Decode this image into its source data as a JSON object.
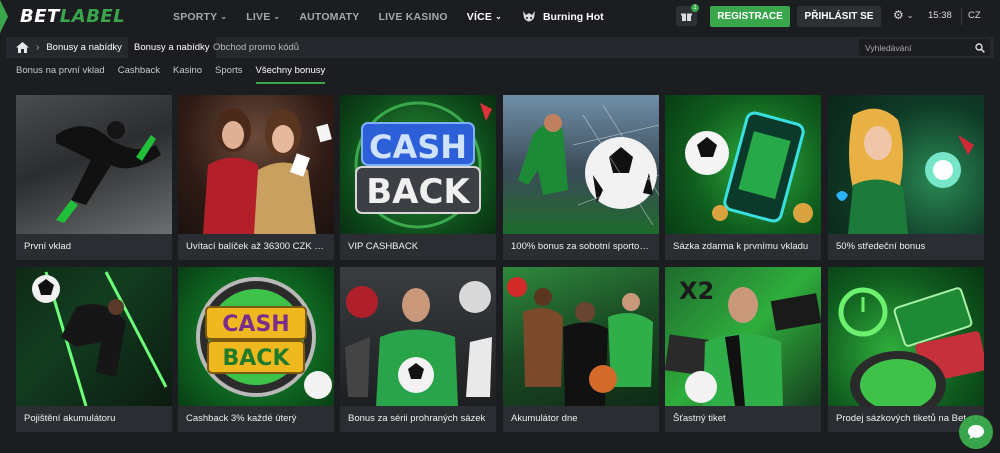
{
  "header": {
    "logo_part1": "BET",
    "logo_part2": "LABEL",
    "nav": [
      {
        "label": "SPORTY",
        "has_dropdown": true
      },
      {
        "label": "LIVE",
        "has_dropdown": true
      },
      {
        "label": "AUTOMATY",
        "has_dropdown": false
      },
      {
        "label": "LIVE KASINO",
        "has_dropdown": false
      },
      {
        "label": "VÍCE",
        "has_dropdown": true
      }
    ],
    "burning_hot": "Burning Hot",
    "gift_badge": "1",
    "register": "REGISTRACE",
    "login": "PŘIHLÁSIT SE",
    "time": "15:38",
    "language": "CZ"
  },
  "breadcrumb": {
    "items": [
      "Bonusy a nabídky"
    ],
    "tabs": [
      "Bonusy a nabídky",
      "Obchod promo kódů"
    ],
    "search_placeholder": "Vyhledávání"
  },
  "subtabs": [
    "Bonus na první vklad",
    "Cashback",
    "Kasino",
    "Sports",
    "Všechny bonusy"
  ],
  "active_subtab": "Všechny bonusy",
  "cards": [
    {
      "title": "První vklad",
      "icon": "football-player-image"
    },
    {
      "title": "Uvítací balíček až 36300 CZK + 1...",
      "icon": "casino-girls-image"
    },
    {
      "title": "VIP CASHBACK",
      "icon": "cashback-neon-image"
    },
    {
      "title": "100% bonus za sobotní sportovn...",
      "icon": "soccer-goal-image"
    },
    {
      "title": "Sázka zdarma k prvnímu vkladu",
      "icon": "phone-football-image"
    },
    {
      "title": "50% středeční bonus",
      "icon": "magic-lady-image"
    },
    {
      "title": "Pojištění akumulátoru",
      "icon": "football-kick-image"
    },
    {
      "title": "Cashback 3% každé úterý",
      "icon": "cashback-gold-image"
    },
    {
      "title": "Bonus za sérii prohraných sázek",
      "icon": "sports-team-image"
    },
    {
      "title": "Akumulátor dne",
      "icon": "athletes-image"
    },
    {
      "title": "Šťastný tiket",
      "icon": "lucky-fan-image"
    },
    {
      "title": "Prodej sázkových tiketů na BetLa...",
      "icon": "ticket-clock-image"
    }
  ],
  "colors": {
    "accent": "#3aa64b",
    "background": "#1b1d20",
    "card": "#2a2d31"
  }
}
